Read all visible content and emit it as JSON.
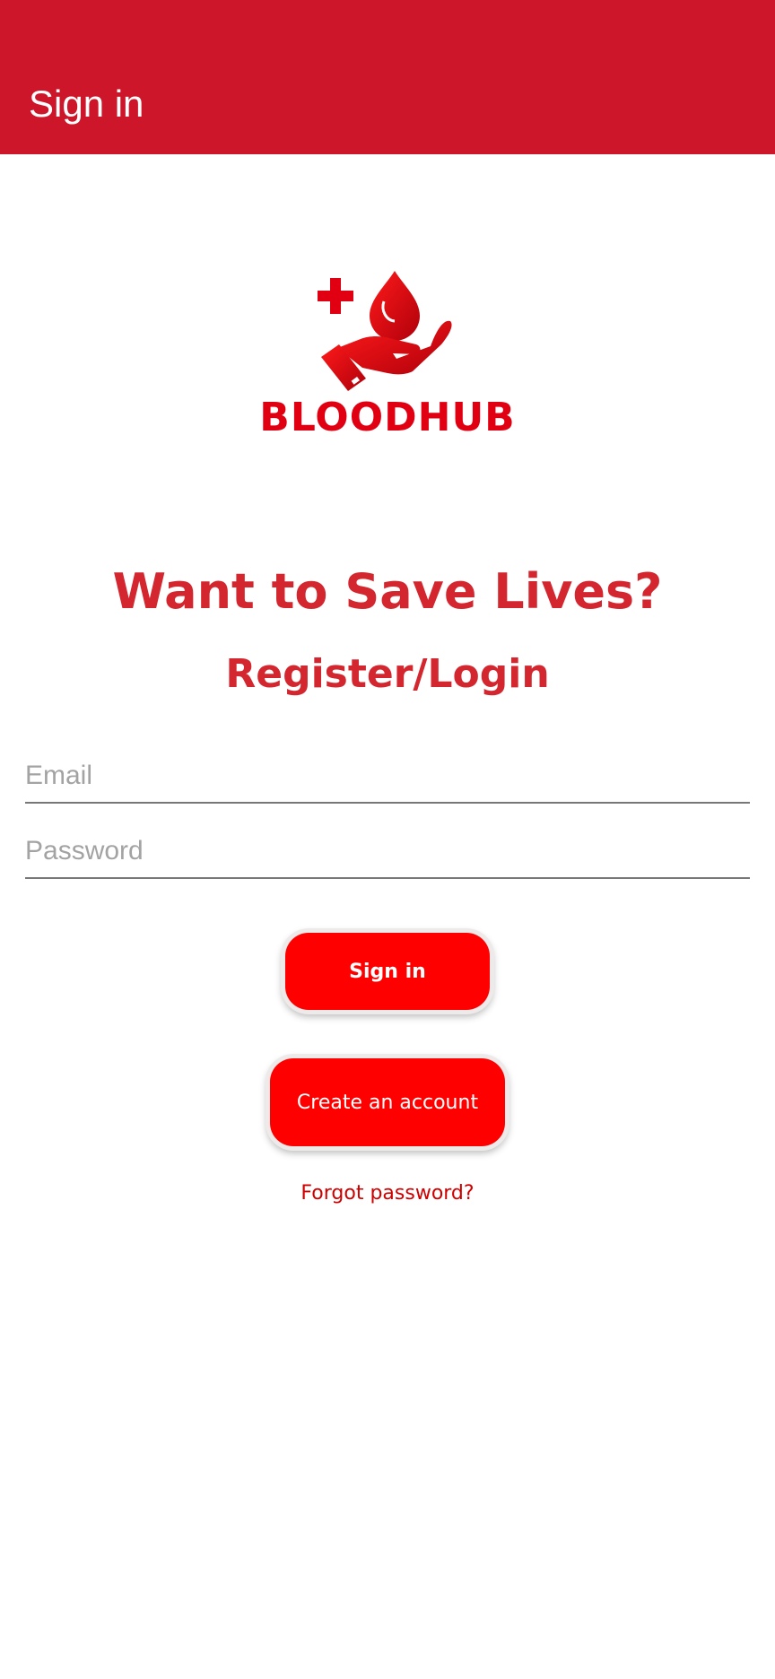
{
  "app_bar": {
    "title": "Sign in",
    "color": "#cd1629"
  },
  "logo": {
    "icon": "hand-blood-drop-cross-icon",
    "brand_name": "BLOODHUB",
    "color": "#e00012"
  },
  "headline": "Want to Save Lives?",
  "subheadline": "Register/Login",
  "form": {
    "email": {
      "value": "",
      "placeholder": "Email"
    },
    "password": {
      "value": "",
      "placeholder": "Password"
    }
  },
  "buttons": {
    "sign_in_label": "Sign in",
    "create_account_label": "Create an account",
    "color": "#ff0000"
  },
  "forgot_password_label": "Forgot password?"
}
